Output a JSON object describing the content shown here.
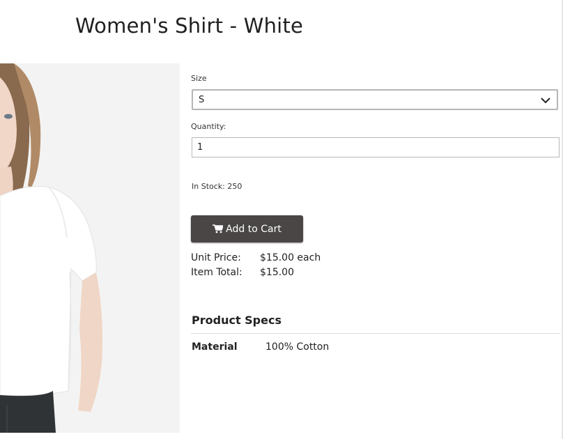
{
  "product": {
    "title": "Women's Shirt - White",
    "image_icon": "product-photo"
  },
  "form": {
    "size_label": "Size",
    "size_value": "S",
    "quantity_label": "Quantity:",
    "quantity_value": "1",
    "stock_text": "In Stock: 250"
  },
  "cart": {
    "button_label": "Add to Cart",
    "icon": "cart-icon",
    "button_color": "#4a4646"
  },
  "pricing": {
    "unit_price_label": "Unit Price:",
    "unit_price_value": "$15.00 each",
    "item_total_label": "Item Total:",
    "item_total_value": "$15.00"
  },
  "specs": {
    "title": "Product Specs",
    "rows": [
      {
        "label": "Material",
        "value": "100% Cotton"
      }
    ]
  }
}
